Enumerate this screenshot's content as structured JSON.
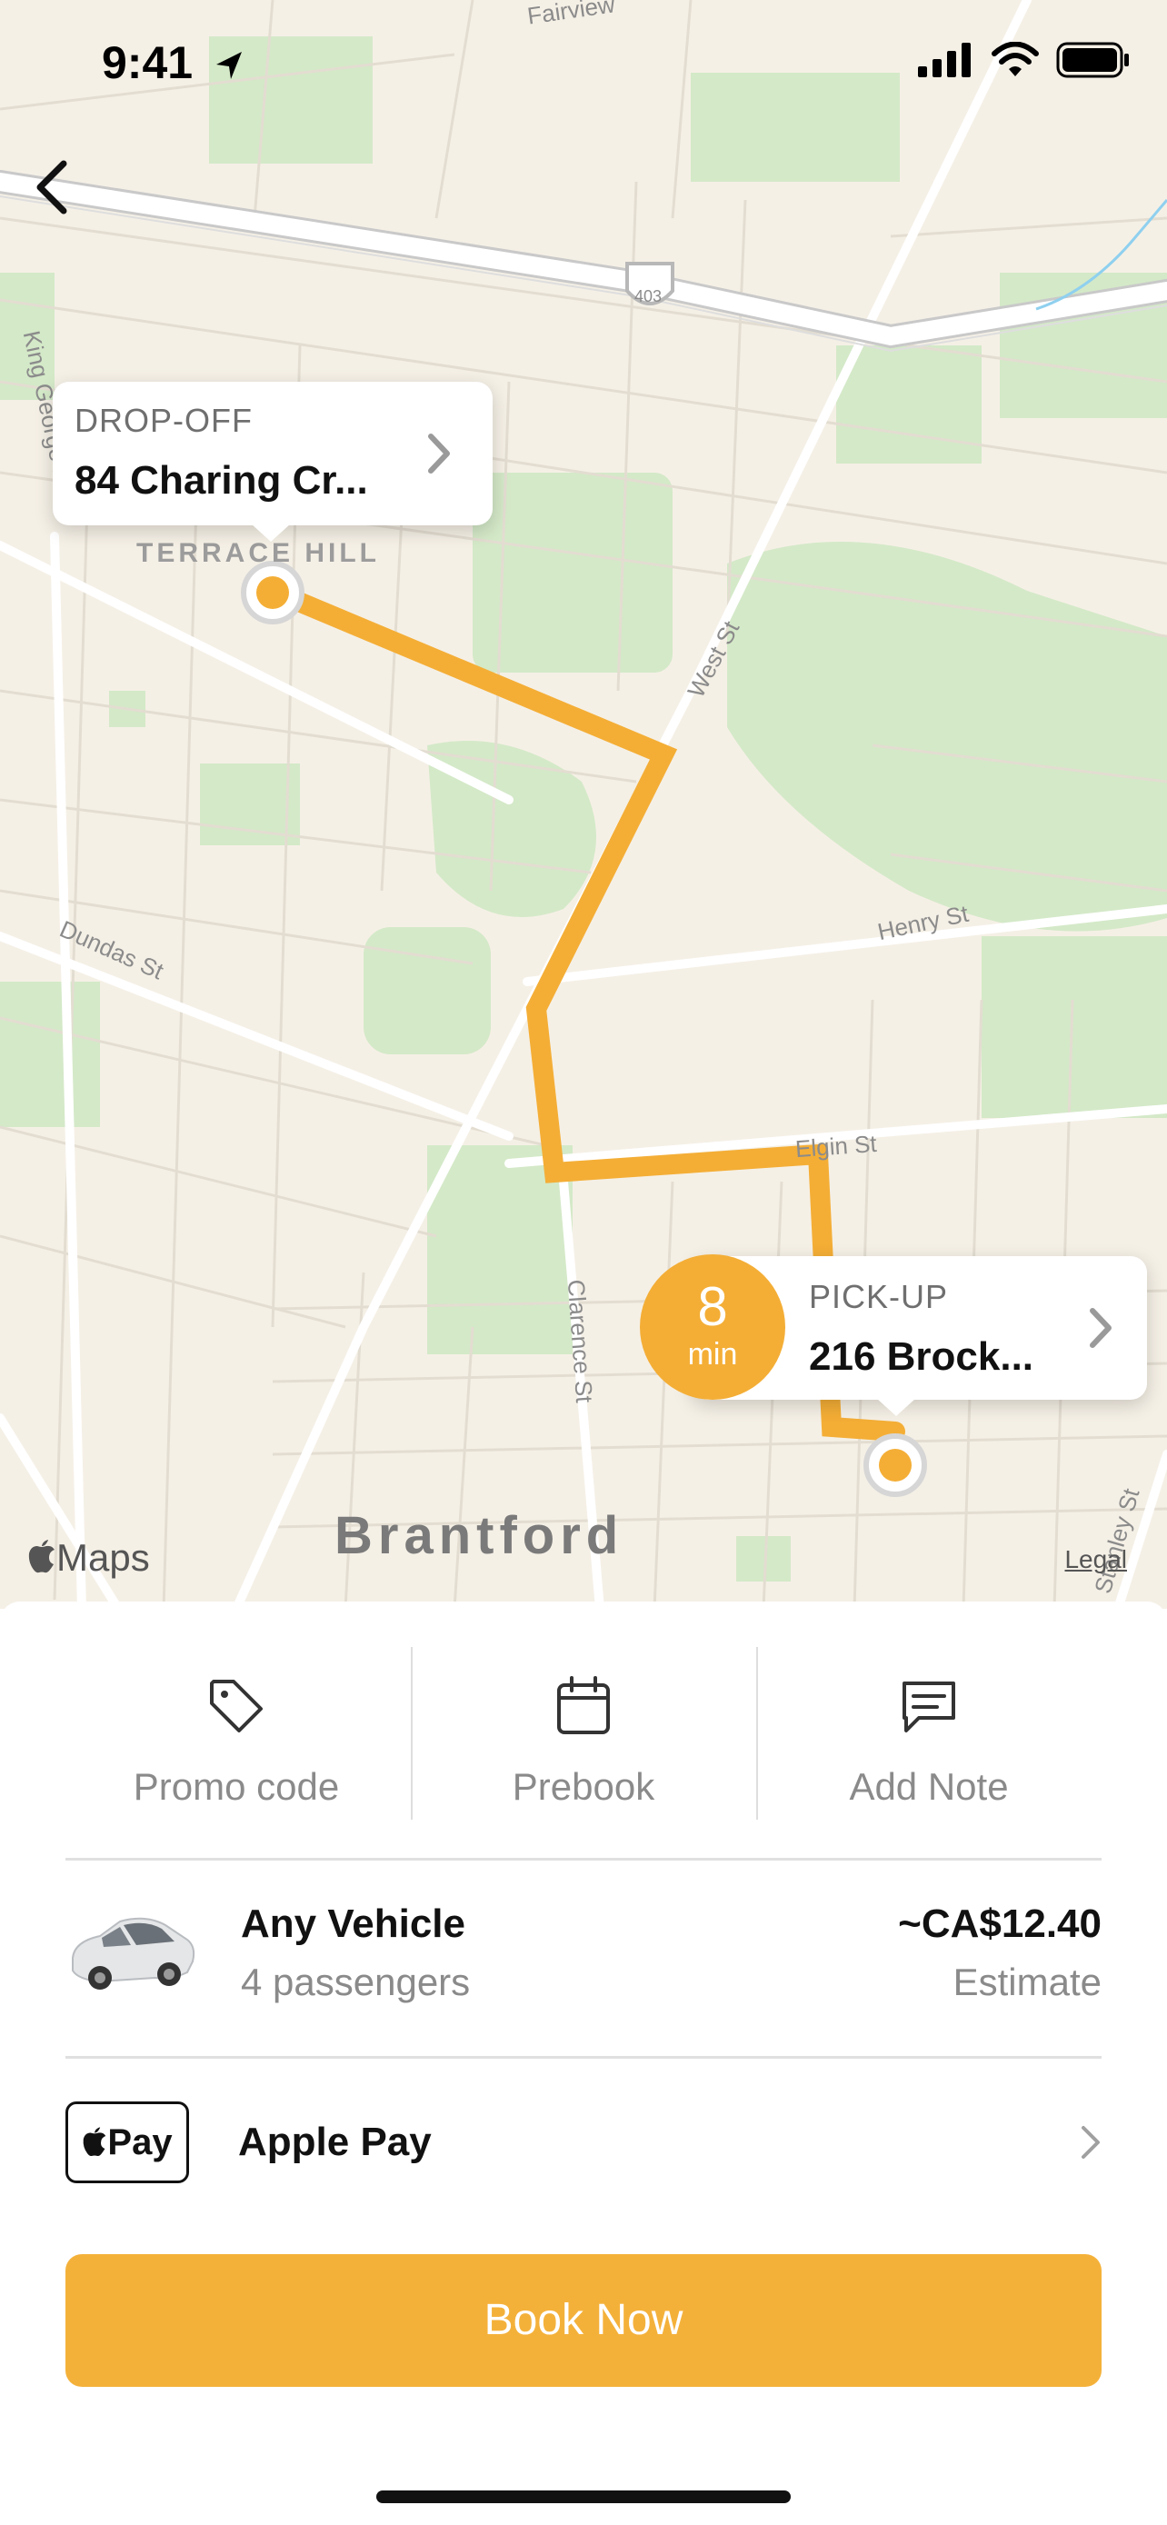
{
  "status_bar": {
    "time": "9:41",
    "location_icon": "location-arrow-icon",
    "signal_icon": "cellular-signal-icon",
    "wifi_icon": "wifi-icon",
    "battery_icon": "battery-icon"
  },
  "nav": {
    "back_icon": "chevron-left-icon"
  },
  "map": {
    "labels": {
      "fairview": "Fairview",
      "king_george": "King George Rd",
      "terrace_hill": "TERRACE HILL",
      "west_st": "West St",
      "dundas": "Dundas St",
      "henry": "Henry St",
      "elgin": "Elgin St",
      "clarence": "Clarence St",
      "stanley": "Stanley St",
      "city": "Brantford",
      "highway": "403"
    },
    "attribution": "Maps",
    "legal": "Legal",
    "route_color": "#F4AE36"
  },
  "dropoff": {
    "title": "DROP-OFF",
    "address": "84 Charing Cr..."
  },
  "pickup": {
    "title": "PICK-UP",
    "address": "216 Brock...",
    "eta_value": "8",
    "eta_unit": "min"
  },
  "actions": [
    {
      "label": "Promo code",
      "icon": "tag-icon"
    },
    {
      "label": "Prebook",
      "icon": "calendar-icon"
    },
    {
      "label": "Add Note",
      "icon": "message-icon"
    }
  ],
  "vehicle": {
    "name": "Any Vehicle",
    "capacity": "4 passengers",
    "price": "~CA$12.40",
    "price_note": "Estimate",
    "image": "car-image"
  },
  "payment": {
    "badge": "Pay",
    "label": "Apple Pay"
  },
  "book_button": "Book Now",
  "colors": {
    "accent": "#F4B13A",
    "map_bg": "#F5F0E6",
    "park": "#CFE6C2"
  }
}
